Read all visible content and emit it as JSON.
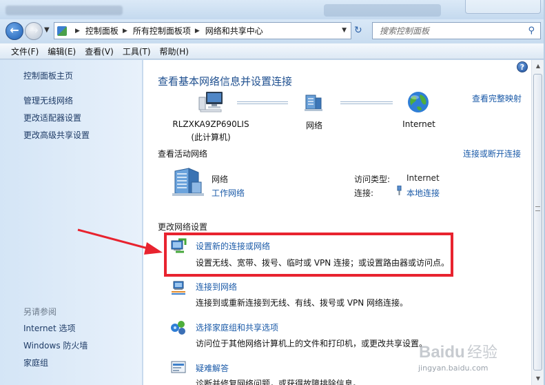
{
  "window": {
    "address": {
      "crumbs": [
        "控制面板",
        "所有控制面板项",
        "网络和共享中心"
      ],
      "search_placeholder": "搜索控制面板"
    },
    "menu": [
      "文件(F)",
      "编辑(E)",
      "查看(V)",
      "工具(T)",
      "帮助(H)"
    ]
  },
  "sidebar": {
    "items": [
      "控制面板主页",
      "管理无线网络",
      "更改适配器设置",
      "更改高级共享设置"
    ],
    "see_also_label": "另请参阅",
    "see_also": [
      "Internet 选项",
      "Windows 防火墙",
      "家庭组"
    ]
  },
  "main": {
    "title": "查看基本网络信息并设置连接",
    "view_full_map": "查看完整映射",
    "nodes": {
      "computer_name": "RLZXKA9ZP690LIS",
      "computer_sub": "(此计算机)",
      "network": "网络",
      "internet": "Internet"
    },
    "active_networks_label": "查看活动网络",
    "connect_or_disconnect": "连接或断开连接",
    "active_network": {
      "name": "网络",
      "type": "工作网络",
      "access_type_label": "访问类型:",
      "access_type_value": "Internet",
      "connection_label": "连接:",
      "connection_value": "本地连接"
    },
    "change_settings_label": "更改网络设置",
    "tasks": [
      {
        "title": "设置新的连接或网络",
        "desc": "设置无线、宽带、拨号、临时或 VPN 连接；或设置路由器或访问点。"
      },
      {
        "title": "连接到网络",
        "desc": "连接到或重新连接到无线、有线、拨号或 VPN 网络连接。"
      },
      {
        "title": "选择家庭组和共享选项",
        "desc": "访问位于其他网络计算机上的文件和打印机，或更改共享设置。"
      },
      {
        "title": "疑难解答",
        "desc": "诊断并修复网络问题，或获得故障排除信息。"
      }
    ]
  },
  "watermark": {
    "brand": "Baidu",
    "brand_cn": "经验",
    "url": "jingyan.baidu.com"
  },
  "colors": {
    "link": "#1a5aa8",
    "title": "#1e4f8f",
    "highlight": "#e8232f"
  }
}
